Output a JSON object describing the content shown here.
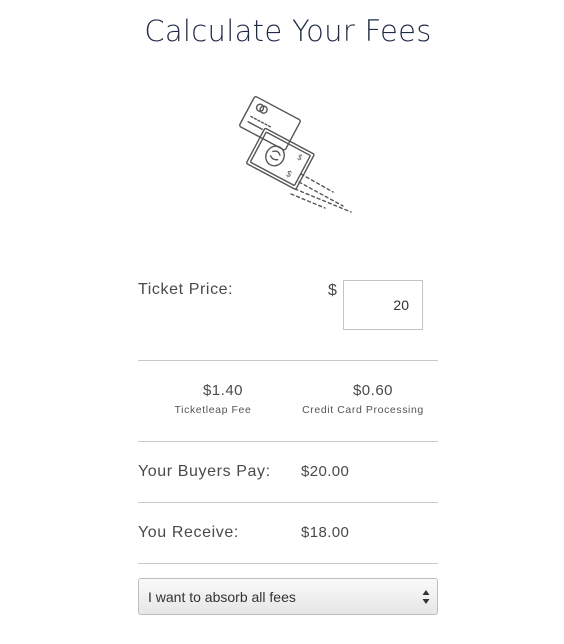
{
  "page": {
    "title": "Calculate Your Fees"
  },
  "ticket_price": {
    "label": "Ticket Price:",
    "currency_symbol": "$",
    "value": "20"
  },
  "fees": [
    {
      "amount": "$1.40",
      "caption": "Ticketleap Fee"
    },
    {
      "amount": "$0.60",
      "caption": "Credit Card Processing"
    }
  ],
  "buyers_pay": {
    "label": "Your Buyers Pay:",
    "value": "$20.00"
  },
  "you_receive": {
    "label": "You Receive:",
    "value": "$18.00"
  },
  "fee_option": {
    "selected": "I want to absorb all fees"
  },
  "icons": {
    "illustration": "credit-card-and-cash-icon",
    "select_arrows": "updown-arrows-icon"
  },
  "colors": {
    "title": "#1f2a44",
    "text": "#4a4a4a",
    "divider": "#c8c8c8",
    "illustration_stroke": "#555555"
  }
}
